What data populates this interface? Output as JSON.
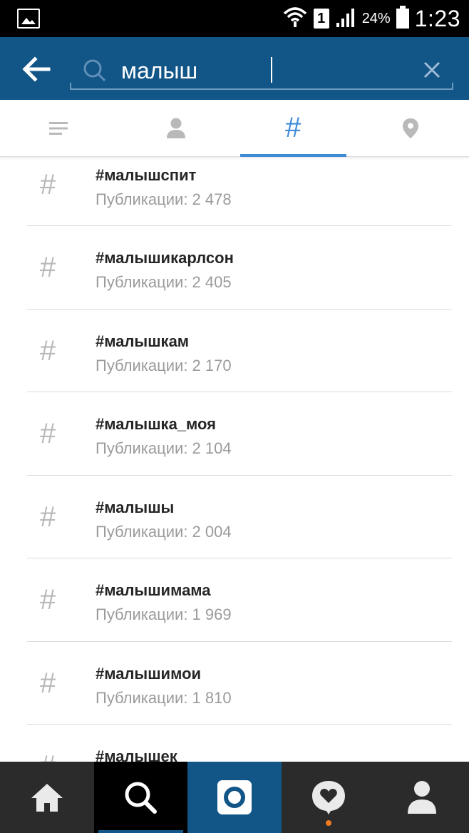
{
  "status_bar": {
    "sim_label": "1",
    "battery_percent": "24%",
    "time": "1:23",
    "icons": [
      "gallery-icon",
      "wifi-icon",
      "sim-icon",
      "signal-icon",
      "battery-icon"
    ]
  },
  "search": {
    "query": "малыш",
    "icons": [
      "back-arrow-icon",
      "search-icon",
      "clear-icon"
    ]
  },
  "tabs": {
    "active": "tags",
    "items": [
      {
        "id": "top",
        "icon": "list-icon"
      },
      {
        "id": "people",
        "icon": "person-icon"
      },
      {
        "id": "tags",
        "label": "#"
      },
      {
        "id": "places",
        "icon": "location-pin-icon"
      }
    ]
  },
  "results": [
    {
      "name": "#малышспит",
      "count": "Публикации: 2 478"
    },
    {
      "name": "#малышикарлсон",
      "count": "Публикации: 2 405"
    },
    {
      "name": "#малышкам",
      "count": "Публикации: 2 170"
    },
    {
      "name": "#малышка_моя",
      "count": "Публикации: 2 104"
    },
    {
      "name": "#малышы",
      "count": "Публикации: 2 004"
    },
    {
      "name": "#малышимама",
      "count": "Публикации: 1 969"
    },
    {
      "name": "#малышимои",
      "count": "Публикации: 1 810"
    },
    {
      "name": "#малышек",
      "count": ""
    }
  ],
  "result_icon": "#",
  "bottom_nav": {
    "items": [
      "home-icon",
      "search-icon",
      "camera-icon",
      "activity-heart-icon",
      "profile-icon"
    ],
    "active": "search"
  },
  "colors": {
    "header_blue": "#125688",
    "accent_blue": "#3f8bd7",
    "nav_dark": "#2b2b2b",
    "notification_orange": "#f07a1e"
  }
}
